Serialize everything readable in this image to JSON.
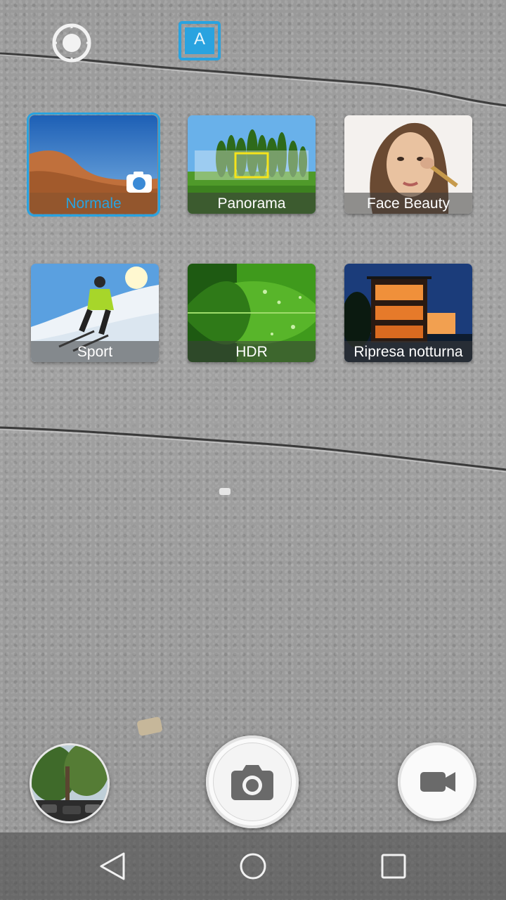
{
  "top_bar": {
    "settings_icon": "settings-aperture-icon",
    "auto_mode_icon": "auto-mode-icon",
    "auto_mode_letter": "A",
    "accent_color": "#29a3e0"
  },
  "modes": [
    {
      "label": "Normale",
      "selected": true,
      "thumb": "desert-landscape"
    },
    {
      "label": "Panorama",
      "selected": false,
      "thumb": "tree-line-panorama"
    },
    {
      "label": "Face Beauty",
      "selected": false,
      "thumb": "portrait-makeup"
    },
    {
      "label": "Sport",
      "selected": false,
      "thumb": "skier"
    },
    {
      "label": "HDR",
      "selected": false,
      "thumb": "green-leaf"
    },
    {
      "label": "Ripresa notturna",
      "selected": false,
      "thumb": "night-house"
    }
  ],
  "controls": {
    "gallery_icon": "gallery-thumbnail",
    "shutter_icon": "camera-icon",
    "video_icon": "video-camera-icon"
  },
  "navbar": {
    "back_icon": "back-triangle-icon",
    "home_icon": "home-circle-icon",
    "recents_icon": "recents-square-icon"
  }
}
